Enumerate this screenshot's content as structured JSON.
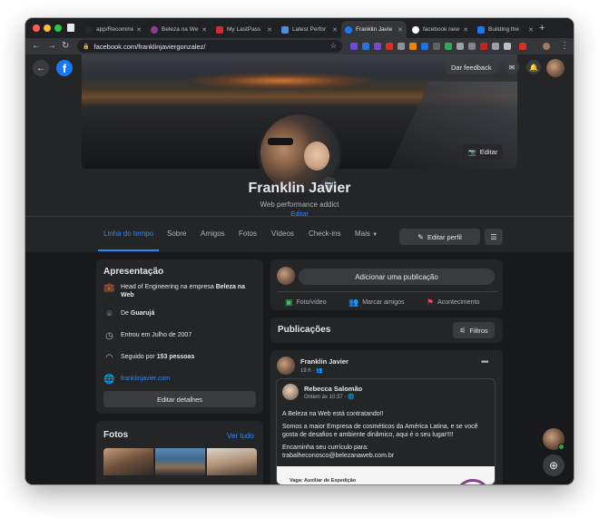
{
  "browser": {
    "tabs": [
      {
        "label": "app/Recomme",
        "icon": "github-icon",
        "color": "#24292e"
      },
      {
        "label": "Beleza na We",
        "icon": "beleza-favicon-icon",
        "color": "#8a3d96"
      },
      {
        "label": "My LastPass",
        "icon": "lastpass-icon",
        "color": "#d32d27"
      },
      {
        "label": "Latest Perfor",
        "icon": "document-icon",
        "color": "#4a90d9"
      },
      {
        "label": "Franklin Javie",
        "icon": "facebook-favicon-icon",
        "color": "#1877f2"
      },
      {
        "label": "facebook new",
        "icon": "google-icon",
        "color": "#ffffff"
      },
      {
        "label": "Building the",
        "icon": "facebook-favicon-icon",
        "color": "#1877f2"
      }
    ],
    "url": "facebook.com/franklinjaviergonzalez/"
  },
  "fb": {
    "feedback_label": "Dar feedback",
    "cover_edit_label": "Editar",
    "name": "Franklin Javier",
    "bio": "Web performance addict",
    "bio_edit": "Editar",
    "nav": {
      "items": [
        "Linha do tempo",
        "Sobre",
        "Amigos",
        "Fotos",
        "Vídeos",
        "Check-ins",
        "Mais"
      ],
      "edit_profile": "Editar perfil"
    },
    "intro": {
      "title": "Apresentação",
      "work_prefix": "Head of Engineering na empresa ",
      "work_company": "Beleza na Web",
      "from_prefix": "De ",
      "from_place": "Guarujá",
      "joined": "Entrou em Julho de 2007",
      "followers_prefix": "Seguido por ",
      "followers_count": "153 pessoas",
      "website": "franklinjavier.com",
      "edit_details": "Editar detalhes"
    },
    "photos": {
      "title": "Fotos",
      "see_all": "Ver tudo"
    },
    "composer": {
      "placeholder": "Adicionar uma publicação",
      "photo": "Foto/vídeo",
      "tag": "Marcar amigos",
      "event": "Acontecimento"
    },
    "posts": {
      "title": "Publicações",
      "filters": "Filtros"
    },
    "post": {
      "author": "Franklin Javier",
      "time": "19 h",
      "shared_author": "Rebecca Salomão",
      "shared_time": "Ontem às 10:37",
      "line1": "A Beleza na Web está contratando!!",
      "line2": "Somos a maior Empresa de cosméticos da América Latina, e se você gosta de desafios e ambiente dinâmico, aqui é o seu lugar!!!!",
      "line3": "Encaminha seu currículo para:",
      "line4": "trabalheconosco@belezanaweb.com.br",
      "job_title": "Vaga: Auxiliar de Expedição"
    }
  }
}
